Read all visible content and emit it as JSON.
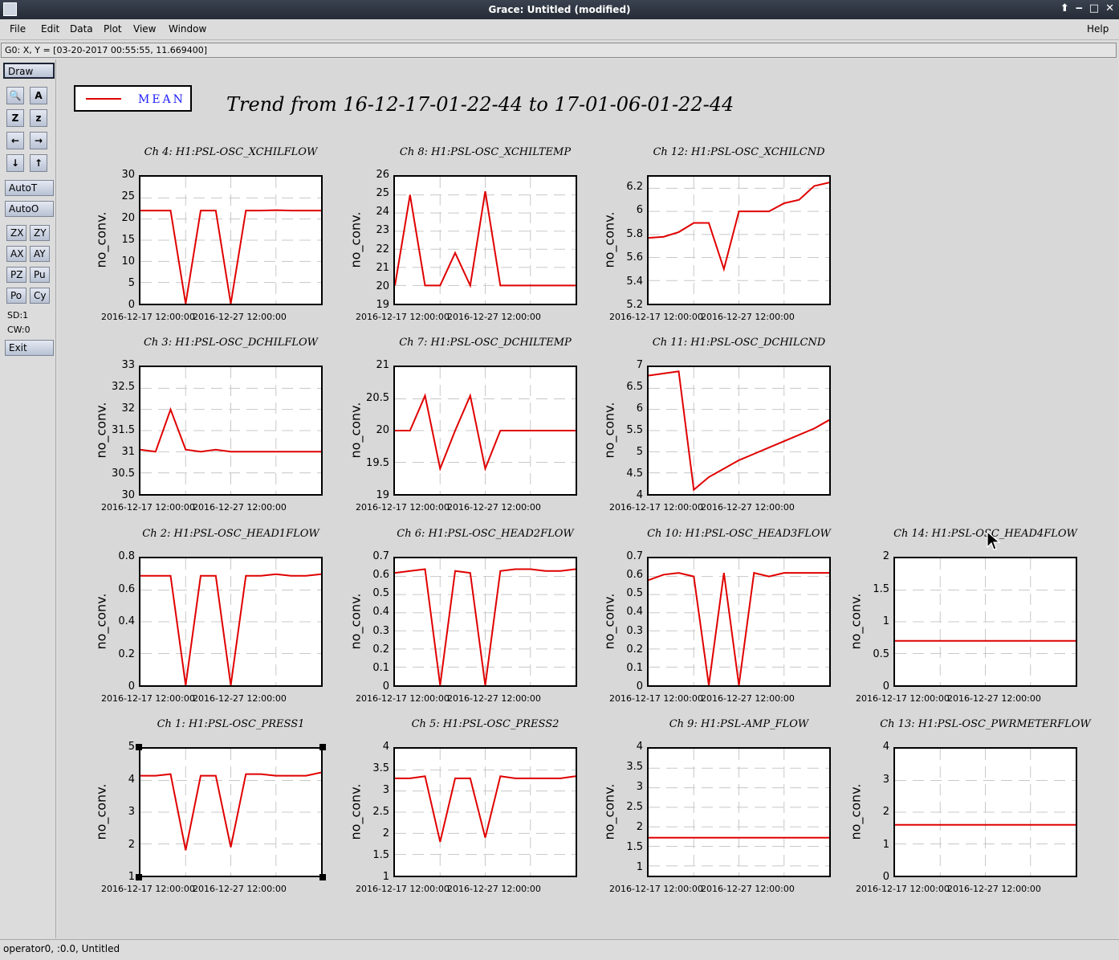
{
  "window": {
    "title": "Grace: Untitled (modified)",
    "controls": [
      "⬆",
      "‒",
      "□",
      "✕"
    ]
  },
  "menu": {
    "file": "File",
    "edit": "Edit",
    "data": "Data",
    "plot": "Plot",
    "view": "View",
    "window": "Window",
    "help": "Help"
  },
  "locator": "G0: X, Y = [03-20-2017 00:55:55, 11.669400]",
  "toolbar": {
    "draw": "Draw",
    "autot": "AutoT",
    "autoo": "AutoO",
    "zx": "ZX",
    "zy": "ZY",
    "ax": "AX",
    "ay": "AY",
    "pz": "PZ",
    "pu": "Pu",
    "po": "Po",
    "cy": "Cy",
    "sd": "SD:1",
    "cw": "CW:0",
    "exit": "Exit",
    "icons": [
      "zoom-icon",
      "autoscale-icon",
      "zoom-in-icon",
      "zoom-out-icon",
      "left-arrow-icon",
      "right-arrow-icon",
      "down-arrow-icon",
      "up-arrow-icon"
    ],
    "icon_glyphs": [
      "🔍",
      "A",
      "Z",
      "z",
      "←",
      "→",
      "↓",
      "↑"
    ]
  },
  "legend": {
    "label": "MEAN",
    "color": "#e00000"
  },
  "graph_title": "Trend from 16-12-17-01-22-44 to 17-01-06-01-22-44",
  "status": "operator0, :0.0, Untitled",
  "ylabel": "no_conv.",
  "xticks": [
    "2016-12-17 12:00:00",
    "2016-12-27 12:00:00"
  ],
  "chart_data": [
    {
      "type": "line",
      "title": "Ch 4: H1:PSL-OSC_XCHILFLOW",
      "ylabel": "no_conv.",
      "ylim": [
        0,
        30
      ],
      "yticks": [
        "30",
        "25",
        "20",
        "15",
        "10",
        "5",
        "0"
      ],
      "xticks": [
        "2016-12-17 12:00:00",
        "2016-12-27 12:00:00"
      ],
      "series": [
        {
          "values": [
            22,
            22,
            22,
            0,
            22,
            22,
            0,
            22,
            22,
            22.1,
            22,
            22,
            22
          ]
        }
      ]
    },
    {
      "type": "line",
      "title": "Ch 8: H1:PSL-OSC_XCHILTEMP",
      "ylabel": "no_conv.",
      "ylim": [
        19,
        26
      ],
      "yticks": [
        "26",
        "25",
        "24",
        "23",
        "22",
        "21",
        "20",
        "19"
      ],
      "xticks": [
        "2016-12-17 12:00:00",
        "2016-12-27 12:00:00"
      ],
      "series": [
        {
          "values": [
            20,
            25,
            20,
            20,
            21.8,
            20,
            25.2,
            20,
            20,
            20,
            20,
            20,
            20
          ]
        }
      ]
    },
    {
      "type": "line",
      "title": "Ch 12: H1:PSL-OSC_XCHILCND",
      "ylabel": "no_conv.",
      "ylim": [
        5.2,
        6.3
      ],
      "yticks": [
        "6.2",
        "6",
        "5.8",
        "5.6",
        "5.4",
        "5.2"
      ],
      "xticks": [
        "2016-12-17 12:00:00",
        "2016-12-27 12:00:00"
      ],
      "series": [
        {
          "values": [
            5.77,
            5.78,
            5.82,
            5.9,
            5.9,
            5.5,
            6,
            6,
            6,
            6.07,
            6.1,
            6.22,
            6.25
          ]
        }
      ]
    },
    {
      "type": "line",
      "title": "Ch 3: H1:PSL-OSC_DCHILFLOW",
      "ylabel": "no_conv.",
      "ylim": [
        30,
        33
      ],
      "yticks": [
        "33",
        "32.5",
        "32",
        "31.5",
        "31",
        "30.5",
        "30"
      ],
      "xticks": [
        "2016-12-17 12:00:00",
        "2016-12-27 12:00:00"
      ],
      "series": [
        {
          "values": [
            31.05,
            31,
            32,
            31.05,
            31,
            31.05,
            31,
            31,
            31,
            31,
            31,
            31,
            31
          ]
        }
      ]
    },
    {
      "type": "line",
      "title": "Ch 7: H1:PSL-OSC_DCHILTEMP",
      "ylabel": "no_conv.",
      "ylim": [
        19,
        21
      ],
      "yticks": [
        "21",
        "20.5",
        "20",
        "19.5",
        "19"
      ],
      "xticks": [
        "2016-12-17 12:00:00",
        "2016-12-27 12:00:00"
      ],
      "series": [
        {
          "values": [
            20,
            20,
            20.55,
            19.4,
            20,
            20.55,
            19.4,
            20,
            20,
            20,
            20,
            20,
            20
          ]
        }
      ]
    },
    {
      "type": "line",
      "title": "Ch 11: H1:PSL-OSC_DCHILCND",
      "ylabel": "no_conv.",
      "ylim": [
        4,
        7
      ],
      "yticks": [
        "7",
        "6.5",
        "6",
        "5.5",
        "5",
        "4.5",
        "4"
      ],
      "xticks": [
        "2016-12-17 12:00:00",
        "2016-12-27 12:00:00"
      ],
      "series": [
        {
          "values": [
            6.8,
            6.85,
            6.9,
            4.1,
            4.4,
            4.6,
            4.8,
            4.95,
            5.1,
            5.25,
            5.4,
            5.55,
            5.75
          ]
        }
      ]
    },
    {
      "type": "line",
      "title": "Ch 2: H1:PSL-OSC_HEAD1FLOW",
      "ylabel": "no_conv.",
      "ylim": [
        0,
        0.8
      ],
      "yticks": [
        "0.8",
        "0.6",
        "0.4",
        "0.2",
        "0"
      ],
      "xticks": [
        "2016-12-17 12:00:00",
        "2016-12-27 12:00:00"
      ],
      "series": [
        {
          "values": [
            0.69,
            0.69,
            0.69,
            0,
            0.69,
            0.69,
            0,
            0.69,
            0.69,
            0.7,
            0.69,
            0.69,
            0.7
          ]
        }
      ]
    },
    {
      "type": "line",
      "title": "Ch 6: H1:PSL-OSC_HEAD2FLOW",
      "ylabel": "no_conv.",
      "ylim": [
        0,
        0.7
      ],
      "yticks": [
        "0.7",
        "0.6",
        "0.5",
        "0.4",
        "0.3",
        "0.2",
        "0.1",
        "0"
      ],
      "xticks": [
        "2016-12-17 12:00:00",
        "2016-12-27 12:00:00"
      ],
      "series": [
        {
          "values": [
            0.62,
            0.63,
            0.64,
            0,
            0.63,
            0.62,
            0,
            0.63,
            0.64,
            0.64,
            0.63,
            0.63,
            0.64
          ]
        }
      ]
    },
    {
      "type": "line",
      "title": "Ch 10: H1:PSL-OSC_HEAD3FLOW",
      "ylabel": "no_conv.",
      "ylim": [
        0,
        0.7
      ],
      "yticks": [
        "0.7",
        "0.6",
        "0.5",
        "0.4",
        "0.3",
        "0.2",
        "0.1",
        "0"
      ],
      "xticks": [
        "2016-12-17 12:00:00",
        "2016-12-27 12:00:00"
      ],
      "series": [
        {
          "values": [
            0.58,
            0.61,
            0.62,
            0.6,
            0,
            0.62,
            0,
            0.62,
            0.6,
            0.62,
            0.62,
            0.62,
            0.62
          ]
        }
      ]
    },
    {
      "type": "line",
      "title": "Ch 14: H1:PSL-OSC_HEAD4FLOW",
      "ylabel": "no_conv.",
      "ylim": [
        0,
        2
      ],
      "yticks": [
        "2",
        "1.5",
        "1",
        "0.5",
        "0"
      ],
      "xticks": [
        "2016-12-17 12:00:00",
        "2016-12-27 12:00:00"
      ],
      "series": [
        {
          "values": [
            0.7,
            0.7,
            0.7,
            0.7,
            0.7,
            0.7,
            0.7,
            0.7,
            0.7,
            0.7,
            0.7,
            0.7,
            0.7
          ]
        }
      ]
    },
    {
      "type": "line",
      "title": "Ch 1: H1:PSL-OSC_PRESS1",
      "ylabel": "no_conv.",
      "ylim": [
        1,
        5
      ],
      "yticks": [
        "5",
        "4",
        "3",
        "2",
        "1"
      ],
      "xticks": [
        "2016-12-17 12:00:00",
        "2016-12-27 12:00:00"
      ],
      "series": [
        {
          "values": [
            4.15,
            4.15,
            4.2,
            1.8,
            4.15,
            4.15,
            1.9,
            4.2,
            4.2,
            4.15,
            4.15,
            4.15,
            4.25
          ]
        }
      ]
    },
    {
      "type": "line",
      "title": "Ch 5: H1:PSL-OSC_PRESS2",
      "ylabel": "no_conv.",
      "ylim": [
        1,
        4
      ],
      "yticks": [
        "4",
        "3.5",
        "3",
        "2.5",
        "2",
        "1.5",
        "1"
      ],
      "xticks": [
        "2016-12-17 12:00:00",
        "2016-12-27 12:00:00"
      ],
      "series": [
        {
          "values": [
            3.3,
            3.3,
            3.35,
            1.8,
            3.3,
            3.3,
            1.9,
            3.35,
            3.3,
            3.3,
            3.3,
            3.3,
            3.35
          ]
        }
      ]
    },
    {
      "type": "line",
      "title": "Ch 9: H1:PSL-AMP_FLOW",
      "ylabel": "no_conv.",
      "ylim": [
        0.75,
        4
      ],
      "yticks": [
        "4",
        "3.5",
        "3",
        "2.5",
        "2",
        "1.5",
        "1"
      ],
      "xticks": [
        "2016-12-17 12:00:00",
        "2016-12-27 12:00:00"
      ],
      "series": [
        {
          "values": [
            1.72,
            1.72,
            1.72,
            1.72,
            1.72,
            1.72,
            1.72,
            1.72,
            1.72,
            1.72,
            1.72,
            1.72,
            1.72
          ]
        }
      ]
    },
    {
      "type": "line",
      "title": "Ch 13: H1:PSL-OSC_PWRMETERFLOW",
      "ylabel": "no_conv.",
      "ylim": [
        0,
        4
      ],
      "yticks": [
        "4",
        "3",
        "2",
        "1",
        "0"
      ],
      "xticks": [
        "2016-12-17 12:00:00",
        "2016-12-27 12:00:00"
      ],
      "series": [
        {
          "values": [
            1.6,
            1.6,
            1.6,
            1.6,
            1.6,
            1.6,
            1.6,
            1.6,
            1.6,
            1.6,
            1.6,
            1.6,
            1.6
          ]
        }
      ]
    }
  ]
}
